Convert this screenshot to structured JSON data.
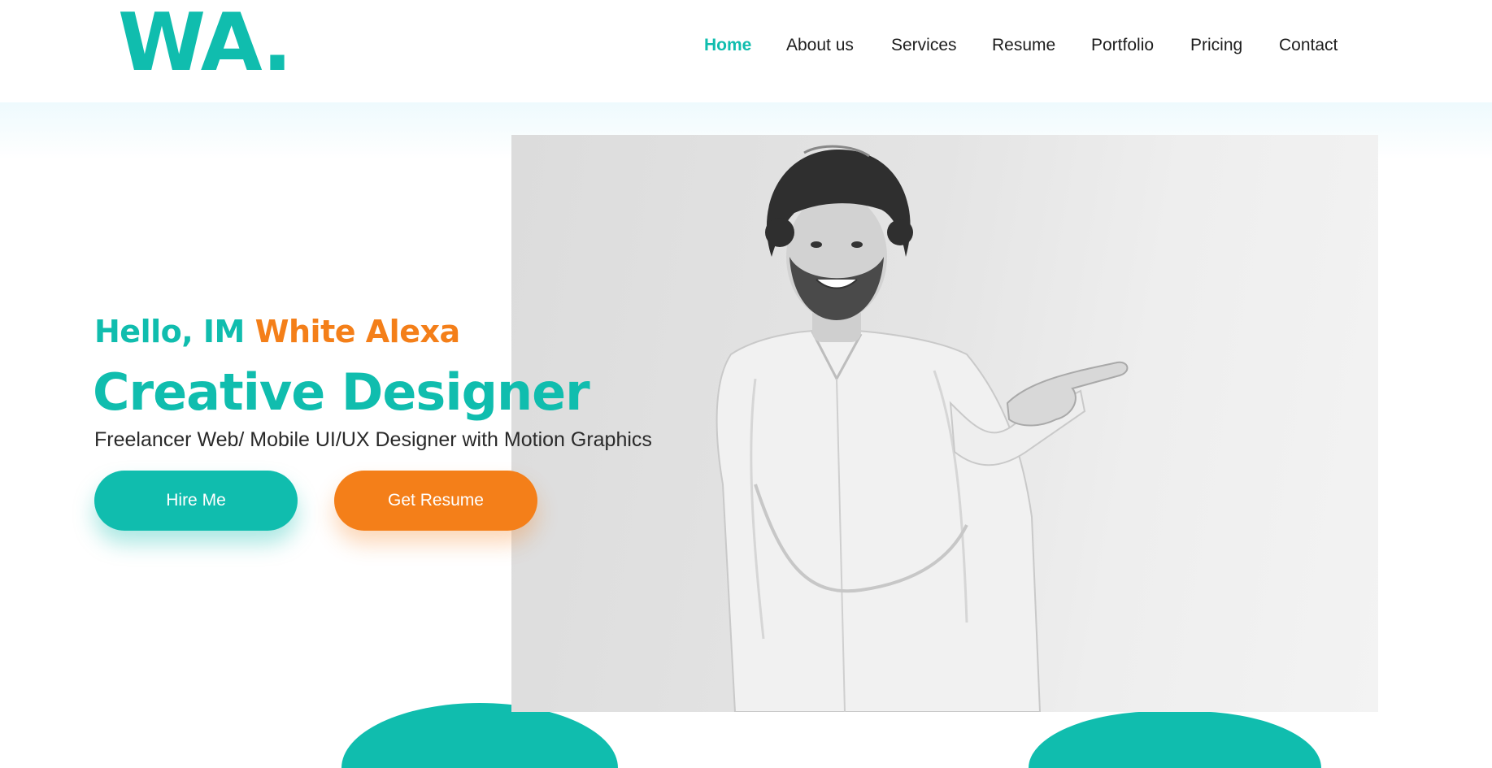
{
  "brand": {
    "logo_text": "WA."
  },
  "nav": {
    "items": [
      {
        "label": "Home",
        "active": true
      },
      {
        "label": "About us",
        "active": false
      },
      {
        "label": "Services",
        "active": false
      },
      {
        "label": "Resume",
        "active": false
      },
      {
        "label": "Portfolio",
        "active": false
      },
      {
        "label": "Pricing",
        "active": false
      },
      {
        "label": "Contact",
        "active": false
      }
    ]
  },
  "hero": {
    "greeting_prefix": "Hello, IM",
    "name": "White Alexa",
    "title": "Creative Designer",
    "subtitle": "Freelancer Web/ Mobile UI/UX Designer with Motion Graphics",
    "hire_button": "Hire Me",
    "resume_button": "Get Resume"
  },
  "colors": {
    "accent": "#10bdae",
    "secondary": "#f47f19",
    "text": "#1d1d1d"
  }
}
